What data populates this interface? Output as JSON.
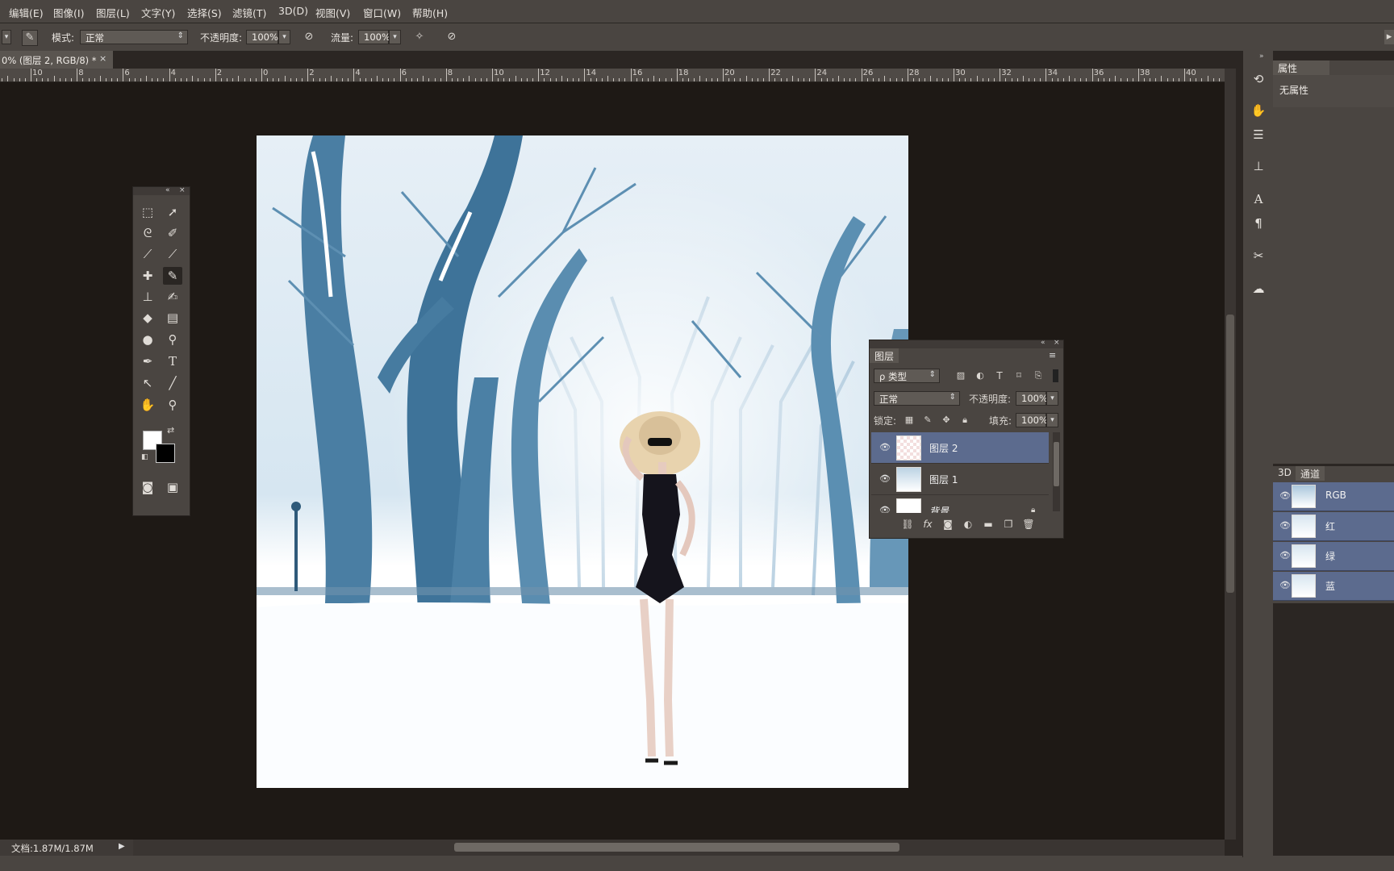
{
  "menu": [
    "编辑(E)",
    "图像(I)",
    "图层(L)",
    "文字(Y)",
    "选择(S)",
    "滤镜(T)",
    "3D(D)",
    "视图(V)",
    "窗口(W)",
    "帮助(H)"
  ],
  "options": {
    "mode_label": "模式:",
    "mode_value": "正常",
    "opacity_label": "不透明度:",
    "opacity_value": "100%",
    "flow_label": "流量:",
    "flow_value": "100%"
  },
  "document": {
    "tab_title": "0% (图层 2, RGB/8) *",
    "close": "×"
  },
  "ruler": [
    "10",
    "8",
    "6",
    "4",
    "2",
    "0",
    "2",
    "4",
    "6",
    "8",
    "10",
    "12",
    "14",
    "16",
    "18",
    "20",
    "22",
    "24",
    "26",
    "28",
    "30",
    "32",
    "34",
    "36",
    "38",
    "40",
    "4"
  ],
  "status": {
    "doc_size": "文档:1.87M/1.87M"
  },
  "properties": {
    "tab": "属性",
    "text": "无属性"
  },
  "channels": {
    "tabs": [
      "3D",
      "通道"
    ],
    "items": [
      {
        "name": "RGB"
      },
      {
        "name": "红"
      },
      {
        "name": "绿"
      },
      {
        "name": "蓝"
      }
    ]
  },
  "layers": {
    "title": "图层",
    "filter_label": "ρ 类型",
    "blend_mode": "正常",
    "opacity_label": "不透明度:",
    "opacity_value": "100%",
    "lock_label": "锁定:",
    "fill_label": "填充:",
    "fill_value": "100%",
    "items": [
      {
        "name": "图层 2",
        "selected": true
      },
      {
        "name": "图层 1",
        "selected": false
      },
      {
        "name": "背景",
        "selected": false
      }
    ]
  },
  "colors": {
    "accent": "#5c6b8e",
    "panel": "#4a4541",
    "canvas": "#1e1915"
  }
}
